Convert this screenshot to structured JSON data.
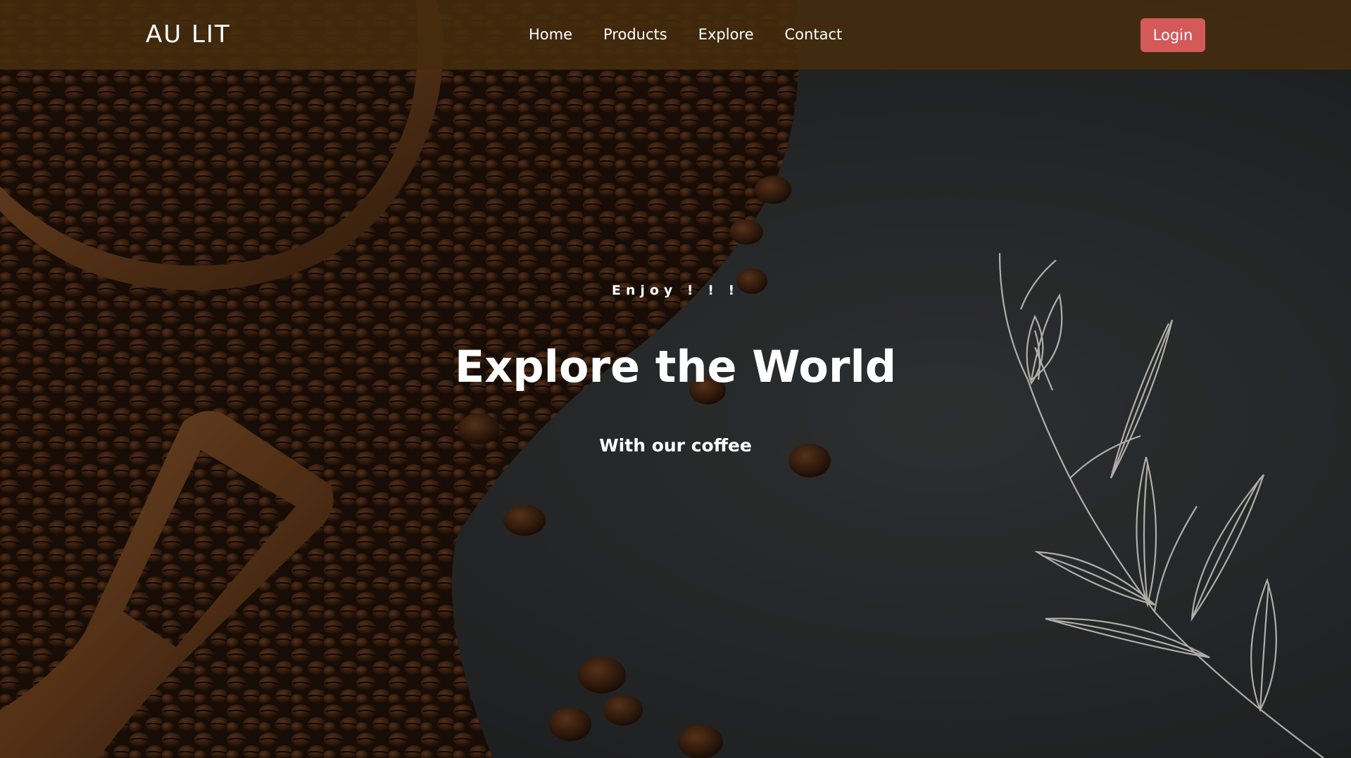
{
  "brand": {
    "name": "AU LIT"
  },
  "nav": {
    "links": [
      {
        "label": "Home"
      },
      {
        "label": "Products"
      },
      {
        "label": "Explore"
      },
      {
        "label": "Contact"
      }
    ],
    "login_label": "Login"
  },
  "hero": {
    "eyebrow": "Enjoy ! ! !",
    "title": "Explore the World",
    "subtitle": "With our coffee",
    "background_image": "coffee beans with wooden bowl and scoop on dark stone surface, line-drawn leaf branch"
  },
  "colors": {
    "navbar_bg": "#462c0e",
    "login_button": "#d45a5a",
    "text": "#ffffff",
    "stone_bg": "#2b2d2e"
  }
}
